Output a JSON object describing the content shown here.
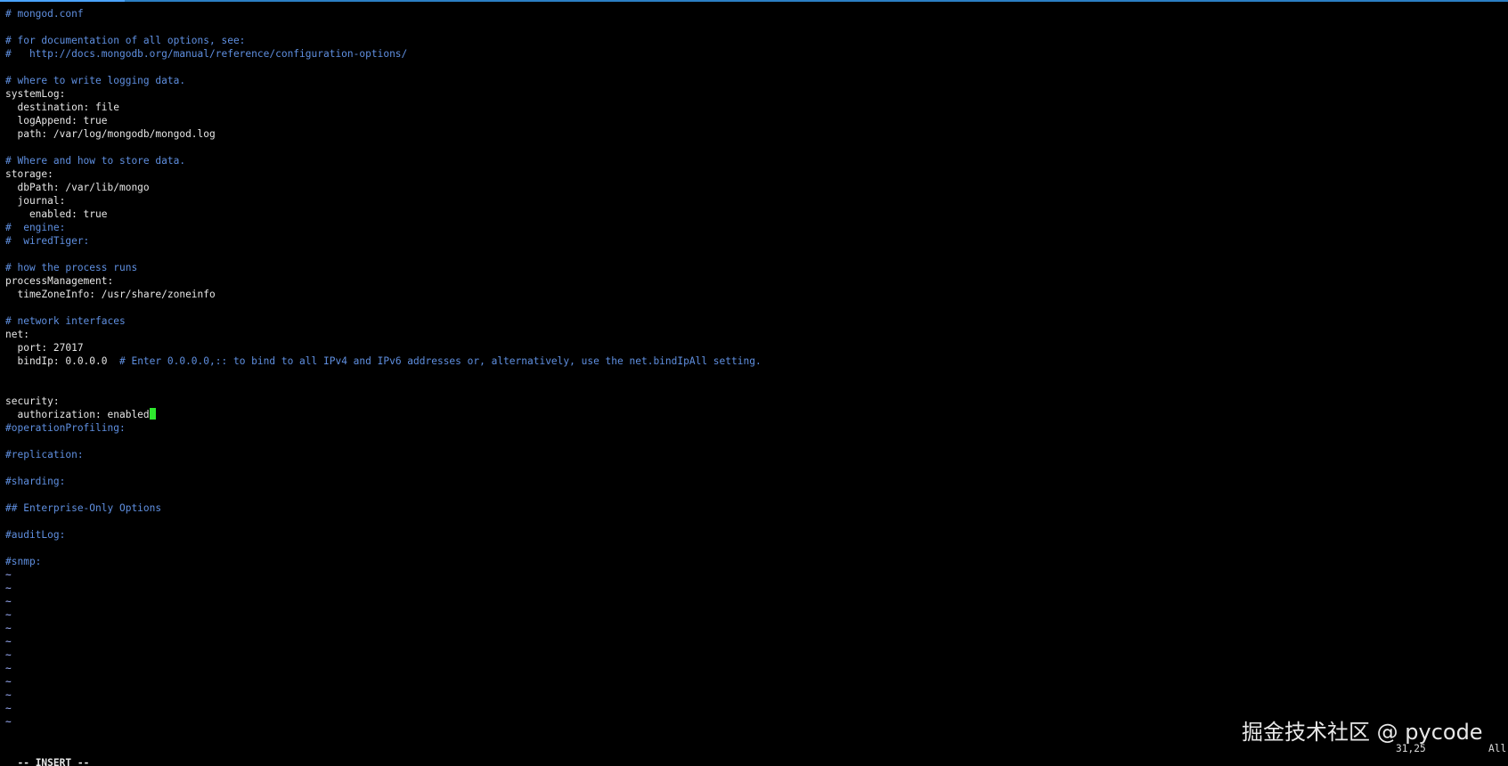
{
  "editor": {
    "lines": [
      {
        "text": "# mongod.conf",
        "kind": "comment"
      },
      {
        "text": "",
        "kind": "plain"
      },
      {
        "text": "# for documentation of all options, see:",
        "kind": "comment"
      },
      {
        "text": "#   http://docs.mongodb.org/manual/reference/configuration-options/",
        "kind": "comment"
      },
      {
        "text": "",
        "kind": "plain"
      },
      {
        "text": "# where to write logging data.",
        "kind": "comment"
      },
      {
        "text": "systemLog:",
        "kind": "plain"
      },
      {
        "text": "  destination: file",
        "kind": "plain"
      },
      {
        "text": "  logAppend: true",
        "kind": "plain"
      },
      {
        "text": "  path: /var/log/mongodb/mongod.log",
        "kind": "plain"
      },
      {
        "text": "",
        "kind": "plain"
      },
      {
        "text": "# Where and how to store data.",
        "kind": "comment"
      },
      {
        "text": "storage:",
        "kind": "plain"
      },
      {
        "text": "  dbPath: /var/lib/mongo",
        "kind": "plain"
      },
      {
        "text": "  journal:",
        "kind": "plain"
      },
      {
        "text": "    enabled: true",
        "kind": "plain"
      },
      {
        "text": "#  engine:",
        "kind": "comment"
      },
      {
        "text": "#  wiredTiger:",
        "kind": "comment"
      },
      {
        "text": "",
        "kind": "plain"
      },
      {
        "text": "# how the process runs",
        "kind": "comment"
      },
      {
        "text": "processManagement:",
        "kind": "plain"
      },
      {
        "text": "  timeZoneInfo: /usr/share/zoneinfo",
        "kind": "plain"
      },
      {
        "text": "",
        "kind": "plain"
      },
      {
        "text": "# network interfaces",
        "kind": "comment"
      },
      {
        "text": "net:",
        "kind": "plain"
      },
      {
        "text": "  port: 27017",
        "kind": "plain"
      },
      {
        "text": "  bindIp: 0.0.0.0  ",
        "kind": "plain",
        "tail": "# Enter 0.0.0.0,:: to bind to all IPv4 and IPv6 addresses or, alternatively, use the net.bindIpAll setting."
      },
      {
        "text": "",
        "kind": "plain"
      },
      {
        "text": "",
        "kind": "plain"
      },
      {
        "text": "security:",
        "kind": "plain"
      },
      {
        "text": "  authorization: enabled",
        "kind": "plain",
        "cursor": true
      },
      {
        "text": "#operationProfiling:",
        "kind": "comment"
      },
      {
        "text": "",
        "kind": "plain"
      },
      {
        "text": "#replication:",
        "kind": "comment"
      },
      {
        "text": "",
        "kind": "plain"
      },
      {
        "text": "#sharding:",
        "kind": "comment"
      },
      {
        "text": "",
        "kind": "plain"
      },
      {
        "text": "## Enterprise-Only Options",
        "kind": "comment"
      },
      {
        "text": "",
        "kind": "plain"
      },
      {
        "text": "#auditLog:",
        "kind": "comment"
      },
      {
        "text": "",
        "kind": "plain"
      },
      {
        "text": "#snmp:",
        "kind": "comment"
      },
      {
        "text": "~",
        "kind": "tilde"
      },
      {
        "text": "~",
        "kind": "tilde"
      },
      {
        "text": "~",
        "kind": "tilde"
      },
      {
        "text": "~",
        "kind": "tilde"
      },
      {
        "text": "~",
        "kind": "tilde"
      },
      {
        "text": "~",
        "kind": "tilde"
      },
      {
        "text": "~",
        "kind": "tilde"
      },
      {
        "text": "~",
        "kind": "tilde"
      },
      {
        "text": "~",
        "kind": "tilde"
      },
      {
        "text": "~",
        "kind": "tilde"
      },
      {
        "text": "~",
        "kind": "tilde"
      },
      {
        "text": "~",
        "kind": "tilde"
      }
    ]
  },
  "status": {
    "mode": "-- INSERT --",
    "position": "31,25",
    "scroll": "All"
  },
  "watermark": "掘金技术社区 @ pycode",
  "colors": {
    "background": "#000000",
    "text": "#e6e6e6",
    "comment": "#5f8fe0",
    "cursor": "#2ee82e"
  }
}
